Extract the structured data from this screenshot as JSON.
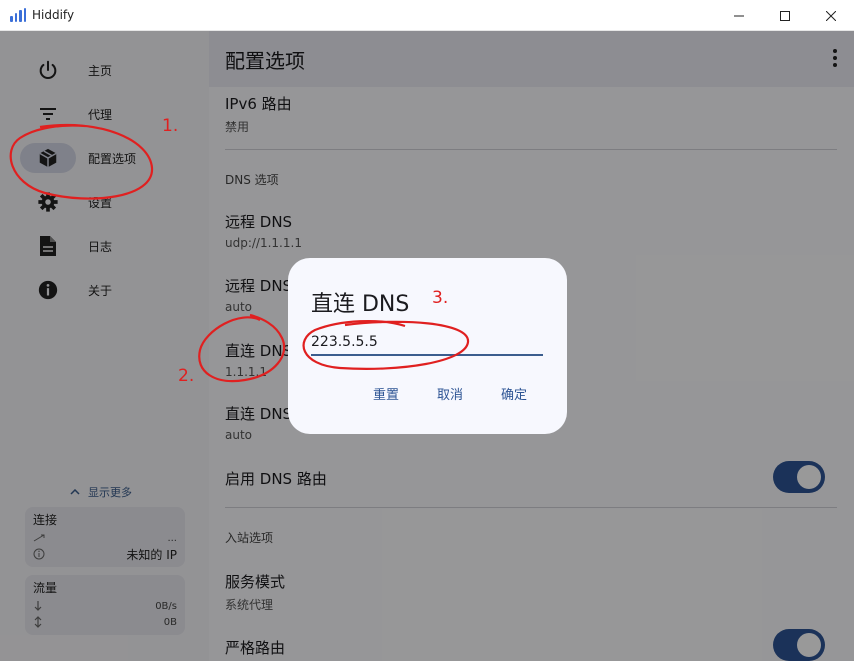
{
  "window": {
    "title": "Hiddify"
  },
  "sidebar": {
    "items": [
      {
        "label": "主页",
        "icon": "power-icon"
      },
      {
        "label": "代理",
        "icon": "filter-icon"
      },
      {
        "label": "配置选项",
        "icon": "box-icon",
        "active": true
      },
      {
        "label": "设置",
        "icon": "gear-icon"
      },
      {
        "label": "日志",
        "icon": "document-icon"
      },
      {
        "label": "关于",
        "icon": "info-icon"
      }
    ],
    "show_more": "显示更多",
    "connection": {
      "title": "连接",
      "row1_value": "...",
      "row2_value": "未知的 IP"
    },
    "traffic": {
      "title": "流量",
      "down": "0B/s",
      "total": "0B"
    }
  },
  "main": {
    "title": "配置选项",
    "ipv6": {
      "title": "IPv6 路由",
      "value": "禁用"
    },
    "dns_section": "DNS 选项",
    "remote_dns": {
      "title": "远程 DNS",
      "value": "udp://1.1.1.1"
    },
    "remote_dns_strategy": {
      "title": "远程 DNS",
      "value": "auto"
    },
    "direct_dns": {
      "title": "直连 DNS",
      "value": "1.1.1.1"
    },
    "direct_dns_strategy": {
      "title": "直连 DNS",
      "value": "auto"
    },
    "enable_dns_routing": {
      "title": "启用 DNS 路由"
    },
    "inbound_section": "入站选项",
    "service_mode": {
      "title": "服务模式",
      "value": "系统代理"
    },
    "strict_route": {
      "title": "严格路由"
    }
  },
  "dialog": {
    "title": "直连 DNS",
    "input_value": "223.5.5.5",
    "reset": "重置",
    "cancel": "取消",
    "ok": "确定"
  },
  "annotations": {
    "n1": "1.",
    "n2": "2.",
    "n3": "3."
  },
  "colors": {
    "accent": "#2d5494",
    "annotation": "#e02020"
  }
}
